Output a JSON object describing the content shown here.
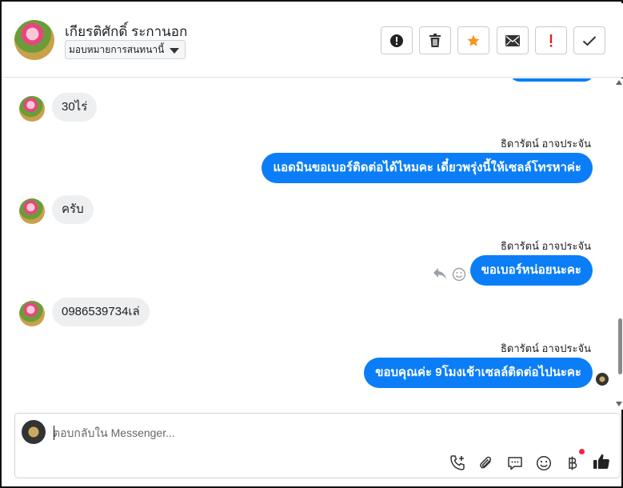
{
  "header": {
    "contact_name": "เกียรติศักดิ์ ระกานอก",
    "assign_label": "มอบหมายการสนทนานี้",
    "toolbar": {
      "spam_icon": "alert-circle-icon",
      "delete_icon": "trash-icon",
      "star_icon": "star-icon",
      "unread_icon": "envelope-icon",
      "important_icon": "exclamation-icon",
      "done_icon": "check-icon"
    }
  },
  "messages": {
    "m1": {
      "direction": "in",
      "text": "30ไร่"
    },
    "m2": {
      "direction": "out",
      "sender": "ธิดารัตน์ อาจประจัน",
      "text": "แอดมินขอเบอร์ติดต่อได้ไหมคะ เดี๋ยวพรุ่งนี้ให้เซลล์โทรหาค่ะ"
    },
    "m3": {
      "direction": "in",
      "text": "ครับ"
    },
    "m4": {
      "direction": "out",
      "sender": "ธิดารัตน์ อาจประจัน",
      "text": "ขอเบอร์หน่อยนะคะ"
    },
    "m5": {
      "direction": "in",
      "text": "0986539734เล่"
    },
    "m6": {
      "direction": "out",
      "sender": "ธิดารัตน์ อาจประจัน",
      "text": "ขอบคุณค่ะ 9โมงเช้าเซลล์ติดต่อไปนะคะ"
    }
  },
  "composer": {
    "placeholder": "ตอบกลับใน Messenger...",
    "icons": [
      "phone-plus-icon",
      "paperclip-icon",
      "speech-bubble-icon",
      "smiley-icon",
      "baht-icon",
      "thumbs-up-icon"
    ]
  },
  "colors": {
    "outgoing_bubble": "#0b7ef7",
    "incoming_bubble": "#eeeff1",
    "star": "#f7931e",
    "important": "#e02020",
    "badge": "#f02849"
  }
}
